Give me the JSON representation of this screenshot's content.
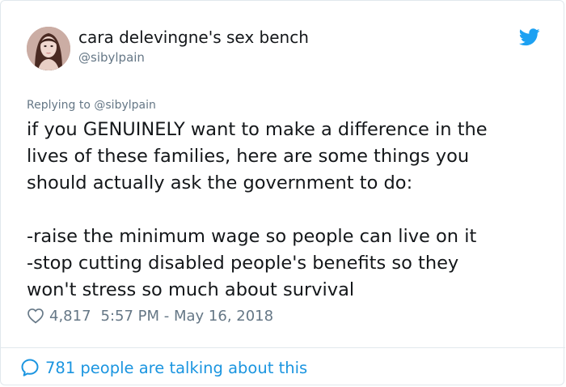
{
  "user": {
    "display_name": "cara delevingne's sex bench",
    "handle": "@sibylpain"
  },
  "tweet": {
    "replying_prefix": "Replying to ",
    "replying_to": "@sibylpain",
    "lines": [
      "if you GENUINELY want to make a difference in the",
      "lives of these families, here are some things you",
      "should actually ask the government to do:",
      "",
      "-raise the minimum wage so people can live on it",
      "-stop cutting disabled people's benefits so they",
      "won't stress so much about survival"
    ],
    "likes": "4,817",
    "timestamp": "5:57 PM - May 16, 2018"
  },
  "footer": {
    "talking_text": "781 people are talking about this"
  },
  "icons": {
    "brand": "twitter-bird-icon",
    "like": "heart-outline-icon",
    "conversation": "speech-bubble-icon"
  },
  "colors": {
    "brand_blue": "#1da1f2",
    "link_blue": "#1b95e0",
    "text": "#14171a",
    "muted": "#657786",
    "border": "#e1e8ed"
  }
}
